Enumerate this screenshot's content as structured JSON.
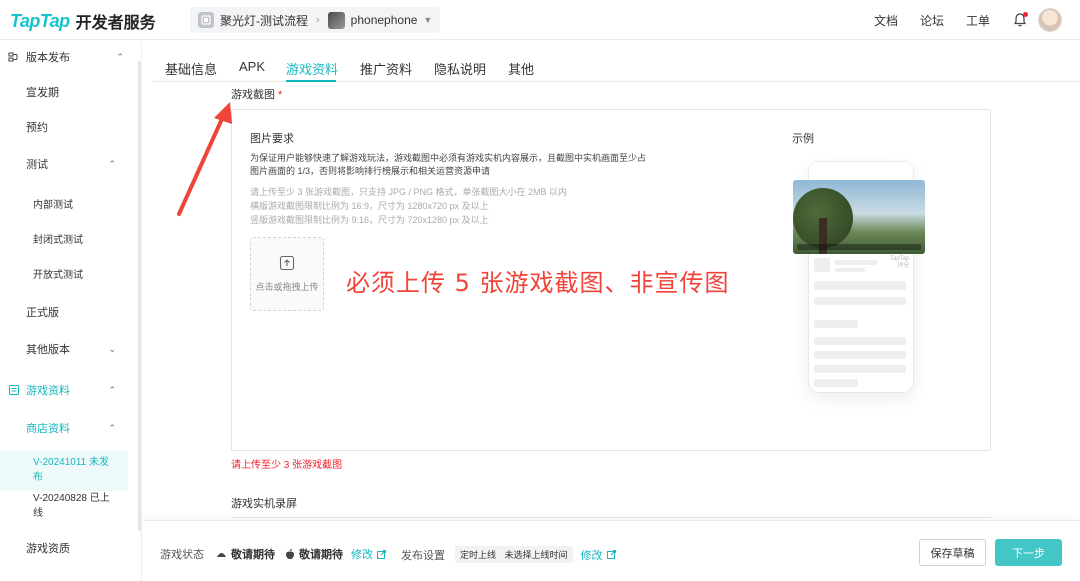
{
  "brand": {
    "logo_tap": "TapTap",
    "logo_sub": "开发者服务"
  },
  "breadcrumb": {
    "project": "聚光灯-测试流程",
    "game": "phonephone"
  },
  "header_links": [
    "文档",
    "论坛",
    "工单"
  ],
  "sidebar": {
    "items": [
      {
        "label": "版本发布",
        "chevron": "up"
      },
      {
        "label": "宣发期"
      },
      {
        "label": "预约"
      },
      {
        "label": "测试",
        "chevron": "up"
      },
      {
        "label": "内部测试"
      },
      {
        "label": "封闭式测试"
      },
      {
        "label": "开放式测试"
      },
      {
        "label": "正式版"
      },
      {
        "label": "其他版本",
        "chevron": "down"
      },
      {
        "label": "游戏资料",
        "chevron": "up"
      },
      {
        "label": "商店资料",
        "chevron": "up"
      },
      {
        "label": "V-20241011 未发布",
        "line1": "V-20241011 未发",
        "line2": "布"
      },
      {
        "label": "V-20240828 已上线",
        "line1": "V-20240828 已上",
        "line2": "线"
      },
      {
        "label": "游戏资质"
      }
    ]
  },
  "tabs": [
    "基础信息",
    "APK",
    "游戏资料",
    "推广资料",
    "隐私说明",
    "其他"
  ],
  "active_tab": "游戏资料",
  "screenshots": {
    "label": "游戏截图",
    "required_mark": "*",
    "req_title": "图片要求",
    "req_desc_1": "为保证用户能够快速了解游戏玩法，游戏截图中必须有游戏实机内容展示，且截图中实机画面至少占",
    "req_desc_2": "图片画面的 1/3，否则将影响排行榜展示和相关运营资源申请",
    "rule_1": "请上传至少 3 张游戏截图，只支持 JPG / PNG 格式，单张截图大小在 2MB 以内",
    "rule_2": "横版游戏截图限制比例为 16:9，尺寸为 1280x720 px 及以上",
    "rule_3": "竖版游戏截图限制比例为 9:16，尺寸为 720x1280 px 及以上",
    "upload_label": "点击或拖拽上传",
    "example_label": "示例",
    "example_watermark_1": "TapTap",
    "example_watermark_2": "评分",
    "error": "请上传至少 3 张游戏截图"
  },
  "annotation": "必须上传 5 张游戏截图、非宣传图",
  "video": {
    "label": "游戏实机录屏"
  },
  "footer": {
    "status_label": "游戏状态",
    "android_status": "敬请期待",
    "ios_status": "敬请期待",
    "edit_1": "修改",
    "publish_label": "发布设置",
    "tag_1": "定时上线",
    "tag_2": "未选择上线时间",
    "edit_2": "修改",
    "save_draft": "保存草稿",
    "next": "下一步"
  },
  "colors": {
    "accent": "#15b8bf",
    "danger": "#f5222d",
    "annotation": "#f04438"
  }
}
